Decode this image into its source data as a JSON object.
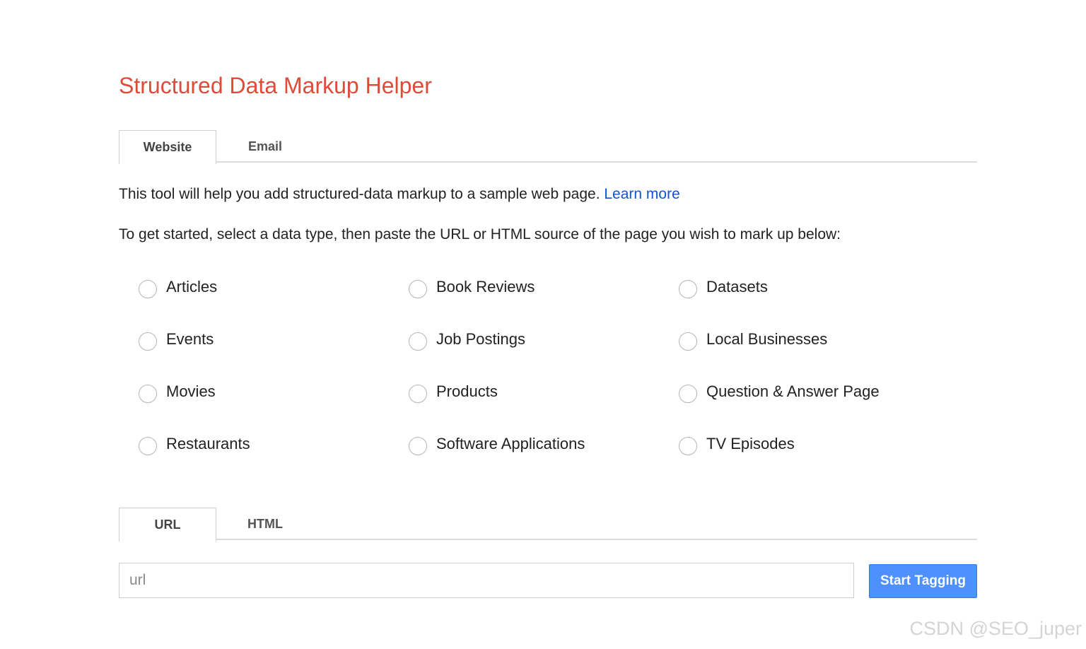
{
  "title": "Structured Data Markup Helper",
  "source_tabs": [
    {
      "label": "Website",
      "active": true
    },
    {
      "label": "Email",
      "active": false
    }
  ],
  "intro": {
    "text": "This tool will help you add structured-data markup to a sample web page. ",
    "link": "Learn more"
  },
  "instructions": "To get started, select a data type, then paste the URL or HTML source of the page you wish to mark up below:",
  "data_types": [
    [
      "Articles",
      "Book Reviews",
      "Datasets"
    ],
    [
      "Events",
      "Job Postings",
      "Local Businesses"
    ],
    [
      "Movies",
      "Products",
      "Question & Answer Page"
    ],
    [
      "Restaurants",
      "Software Applications",
      "TV Episodes"
    ]
  ],
  "input_tabs": [
    {
      "label": "URL",
      "active": true
    },
    {
      "label": "HTML",
      "active": false
    }
  ],
  "url_input": {
    "placeholder": "url",
    "value": ""
  },
  "start_button": "Start Tagging",
  "watermark": "CSDN @SEO_juper",
  "colors": {
    "title": "#dd4b39",
    "link": "#1155cc",
    "button": "#4d90fe"
  }
}
